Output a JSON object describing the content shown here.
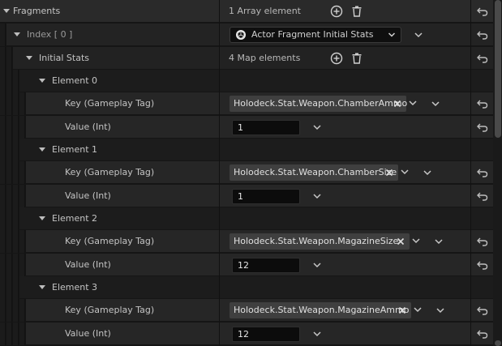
{
  "fragments": {
    "label": "Fragments",
    "count": "1 Array element"
  },
  "index": {
    "label": "Index [ 0 ]",
    "type_value": "Actor Fragment Initial Stats"
  },
  "initial_stats": {
    "label": "Initial Stats",
    "count": "4 Map elements"
  },
  "elements": [
    {
      "label": "Element 0",
      "key_label": "Key (Gameplay Tag)",
      "key_value": "Holodeck.Stat.Weapon.ChamberAmmo",
      "value_label": "Value (Int)",
      "value": "1"
    },
    {
      "label": "Element 1",
      "key_label": "Key (Gameplay Tag)",
      "key_value": "Holodeck.Stat.Weapon.ChamberSize",
      "value_label": "Value (Int)",
      "value": "1"
    },
    {
      "label": "Element 2",
      "key_label": "Key (Gameplay Tag)",
      "key_value": "Holodeck.Stat.Weapon.MagazineSize",
      "value_label": "Value (Int)",
      "value": "12"
    },
    {
      "label": "Element 3",
      "key_label": "Key (Gameplay Tag)",
      "key_value": "Holodeck.Stat.Weapon.MagazineAmmo",
      "value_label": "Value (Int)",
      "value": "12"
    }
  ],
  "colors": {
    "panel_bg": "#151515",
    "row_bg": "#262626",
    "category_bg": "#1e1e1e",
    "tag_bg": "#3f3f3f",
    "input_bg": "#0c0c0c"
  }
}
